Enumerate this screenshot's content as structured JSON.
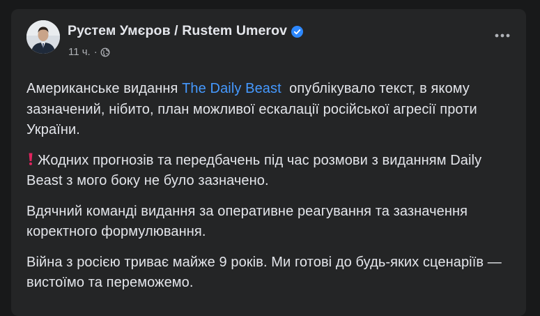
{
  "post": {
    "author": {
      "name": "Рустем Умєров / Rustem Umerov",
      "verified_icon": "verified-badge-icon",
      "badge_color": "#2d88ff"
    },
    "meta": {
      "time": "11 ч.",
      "separator": "·",
      "privacy_icon": "globe-icon"
    },
    "menu_icon": "more-horizontal-icon",
    "paragraphs": {
      "p1": {
        "text_before": "Американське видання ",
        "link_text": "The Daily Beast",
        "text_after": "  опублікувало текст, в якому зазначений, нібито, план можливої ескалації російської агресії проти України."
      },
      "p2": {
        "icon": "red-exclamation-icon",
        "text": "Жодних прогнозів та передбачень під час розмови з виданням Daily Beast з мого боку не було зазначено."
      },
      "p3": {
        "text": "Вдячний команді видання за оперативне реагування та зазначення коректного формулювання."
      },
      "p4": {
        "text": "Війна з росією триває майже 9 років. Ми готові до будь-яких сценаріїв — вистоїмо та переможемо."
      }
    }
  },
  "colors": {
    "page_background": "#18191a",
    "card_background": "#242526",
    "primary_text": "#e4e6eb",
    "secondary_text": "#b0b3b8",
    "link": "#4599ff",
    "exclamation": "#e0245e"
  }
}
